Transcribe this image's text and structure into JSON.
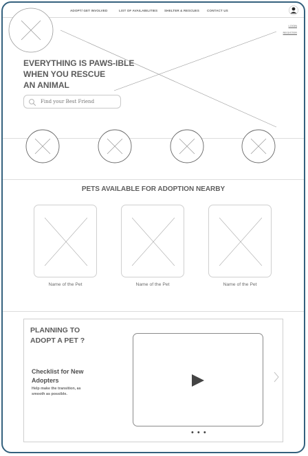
{
  "nav": {
    "links": [
      "ADOPT/ GET INVOLVED",
      "LIST OF AVAILABILITIES",
      "SHELTER & RESCUES",
      "CONTACT US"
    ],
    "login": "LOGIN",
    "register": "REGISTER",
    "user_icon": "user-icon"
  },
  "hero": {
    "title_lines": [
      "EVERYTHING IS PAWS-IBLE",
      "WHEN YOU RESCUE",
      "AN ANIMAL"
    ],
    "search_placeholder": "Find your Best Friend"
  },
  "pets": {
    "title": "PETS AVAILABLE FOR ADOPTION NEARBY",
    "items": [
      {
        "name": "Name of the Pet"
      },
      {
        "name": "Name of the Pet"
      },
      {
        "name": "Name of the Pet"
      }
    ]
  },
  "plan": {
    "title_lines": [
      "PLANNING TO",
      "ADOPT A PET ?"
    ],
    "checklist_title_lines": [
      "Checklist for New",
      "Adopters"
    ],
    "checklist_sub_lines": [
      "Help make the transition, as",
      "smooth as possible."
    ],
    "carousel_dots": "• • •",
    "video_icon": "play-icon"
  },
  "colors": {
    "frame_border": "#33607d",
    "placeholder_stroke": "#8a8a8a",
    "divider": "#dcdcdc"
  }
}
